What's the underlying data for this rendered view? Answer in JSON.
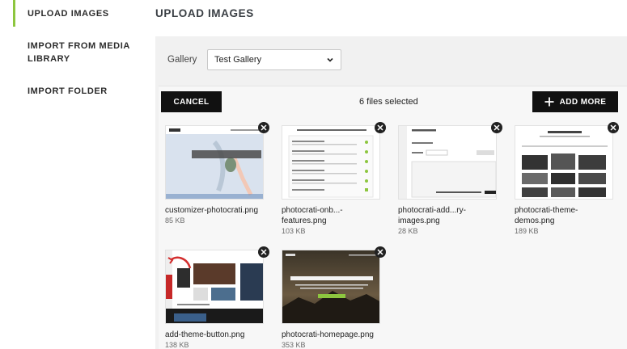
{
  "sidebar": {
    "items": [
      {
        "label": "UPLOAD IMAGES",
        "active": true
      },
      {
        "label": "IMPORT FROM MEDIA LIBRARY",
        "active": false
      },
      {
        "label": "IMPORT FOLDER",
        "active": false
      }
    ],
    "accent": "#8dc63f"
  },
  "main": {
    "title": "UPLOAD IMAGES",
    "gallery_label": "Gallery",
    "gallery_selected": "Test Gallery"
  },
  "uploader": {
    "cancel_label": "CANCEL",
    "status_text": "6 files selected",
    "add_more_label": "ADD MORE"
  },
  "files": [
    {
      "name": "customizer-photocrati.png",
      "size": "85 KB",
      "thumb_caption": "Capturing Beautiful Moments..."
    },
    {
      "name": "photocrati-onb...-features.png",
      "size": "103 KB",
      "thumb_caption": "Add Your Unlimited Features to Your Free Download"
    },
    {
      "name": "photocrati-add...ry-images.png",
      "size": "28 KB",
      "thumb_caption": "Drag image and ZIP files here or"
    },
    {
      "name": "photocrati-theme-demos.png",
      "size": "189 KB",
      "thumb_caption": ""
    },
    {
      "name": "add-theme-button.png",
      "size": "138 KB",
      "thumb_caption": ""
    },
    {
      "name": "photocrati-homepage.png",
      "size": "353 KB",
      "thumb_caption": "WordPress Theme for Photographers"
    }
  ],
  "icons": {
    "remove": "close-circle-icon",
    "add": "plus-icon",
    "dropdown": "chevron-down-icon"
  }
}
